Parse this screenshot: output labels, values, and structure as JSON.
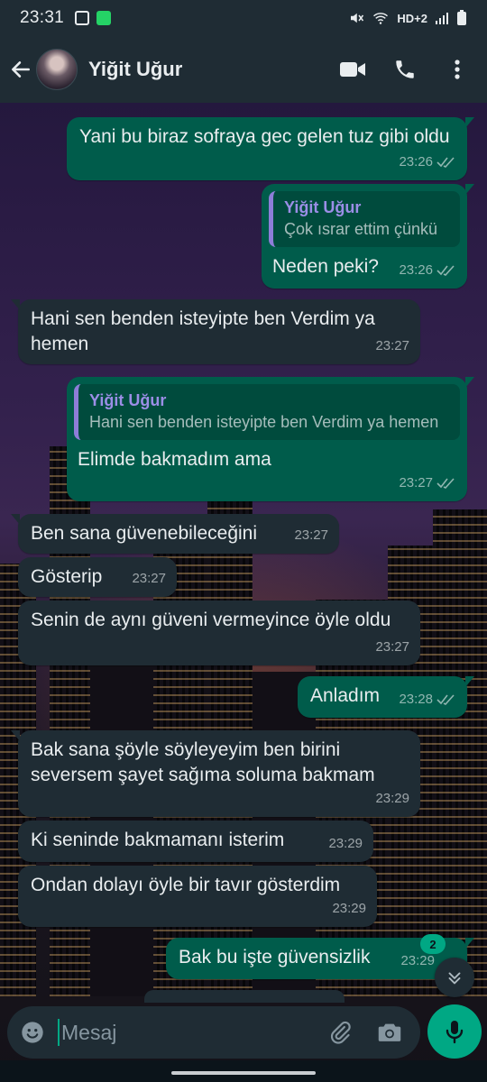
{
  "status": {
    "time": "23:31",
    "net": "HD+2"
  },
  "header": {
    "contact_name": "Yiğit Uğur"
  },
  "messages": [
    {
      "dir": "out",
      "text": "Yani bu biraz sofraya gec gelen tuz gibi oldu",
      "time": "23:26"
    },
    {
      "dir": "out",
      "quote_name": "Yiğit Uğur",
      "quote_text": "Çok ısrar ettim çünkü",
      "text": "Neden peki?",
      "time": "23:26"
    },
    {
      "dir": "in",
      "text": "Hani sen benden isteyipte ben Verdim ya hemen",
      "time": "23:27"
    },
    {
      "dir": "out",
      "quote_name": "Yiğit Uğur",
      "quote_text": "Hani sen benden isteyipte ben Verdim ya hemen",
      "text": "Elimde bakmadım ama",
      "time": "23:27"
    },
    {
      "dir": "in",
      "text": "Ben sana güvenebileceğini",
      "time": "23:27"
    },
    {
      "dir": "in",
      "text": "Gösterip",
      "time": "23:27"
    },
    {
      "dir": "in",
      "text": "Senin de aynı güveni vermeyince öyle oldu",
      "time": "23:27"
    },
    {
      "dir": "out",
      "text": "Anladım",
      "time": "23:28"
    },
    {
      "dir": "in",
      "text": "Bak sana şöyle söyleyeyim ben birini seversem şayet sağıma soluma bakmam",
      "time": "23:29"
    },
    {
      "dir": "in",
      "text": "Ki seninde bakmamanı isterim",
      "time": "23:29"
    },
    {
      "dir": "in",
      "text": "Ondan dolayı öyle bir tavır gösterdim",
      "time": "23:29"
    },
    {
      "dir": "out",
      "text": "Bak bu işte güvensizlik",
      "time": "23:29"
    }
  ],
  "unread_count": "2",
  "composer": {
    "placeholder": "Mesaj"
  },
  "colors": {
    "outgoing_bubble": "#005c4b",
    "incoming_bubble": "#1f2c34",
    "accent": "#00a884",
    "quote_name": "#9b8ee6"
  },
  "icons": [
    "back-arrow-icon",
    "video-call-icon",
    "voice-call-icon",
    "more-options-icon",
    "emoji-icon",
    "attach-icon",
    "camera-icon",
    "mic-icon",
    "scroll-down-icon"
  ]
}
